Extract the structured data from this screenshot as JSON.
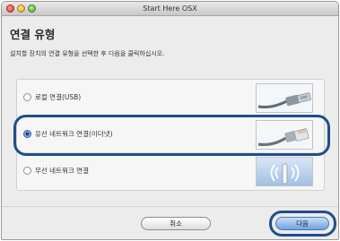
{
  "window": {
    "title": "Start Here OSX"
  },
  "heading": "연결 유형",
  "instruction": "설치할 장치의 연결 유형을 선택한 후 다음을 클릭하십시오.",
  "options": [
    {
      "label": "로컬 연결(USB)",
      "selected": false,
      "icon": "usb-cable-icon"
    },
    {
      "label": "유선 네트워크 연결(이더넷)",
      "selected": true,
      "icon": "ethernet-cable-icon"
    },
    {
      "label": "무선 네트워크 연결",
      "selected": false,
      "icon": "wireless-antenna-icon"
    }
  ],
  "buttons": {
    "cancel_label": "취소",
    "next_label": "다음"
  },
  "colors": {
    "highlight": "#1f4e8c",
    "default_button": "#6ea3e3"
  }
}
